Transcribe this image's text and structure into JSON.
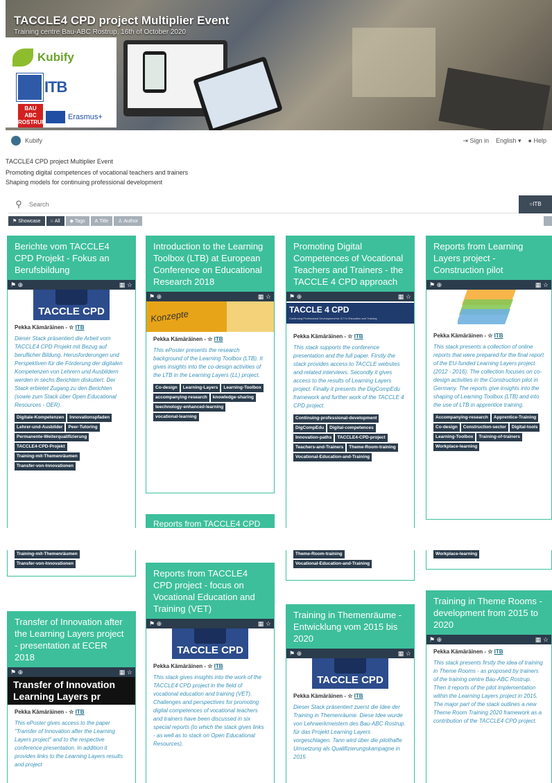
{
  "banner": {
    "title": "TACCLE4 CPD project Multiplier Event",
    "subtitle": "Training centre Bau-ABC Rostrup, 16th of October 2020",
    "kubify": "Kubify",
    "itb": "ITB",
    "bau": "BAU ABC ROSTRUP",
    "erasmus": "Erasmus+"
  },
  "nav": {
    "brand": "Kubify",
    "signin": "Sign in",
    "language": "English",
    "help": "Help"
  },
  "description": {
    "line1": "TACCLE4 CPD project Multiplier Event",
    "line2": "Promoting digital competences of vocational teachers and trainers",
    "line3": "Shaping models for continuing professional development"
  },
  "search": {
    "placeholder": "Search",
    "itb_button": "ITB"
  },
  "filters": [
    "Showcase",
    "All",
    "Tags",
    "Title",
    "Author"
  ],
  "author_name": "Pekka Kämäräinen - ☆",
  "author_org": "ITB",
  "cards": [
    {
      "title": "Berichte vom TACCLE4 CPD Projekt - Fokus an Berufsbildung",
      "image": "TACCLE CPD",
      "desc": "Dieser Stack präsentiert die Arbeit vom TACCLE4 CPD Projekt mit Bezug auf beruflicher Bildung. Herusforderungen und Perspektiven für die Förderung der digitalen Kompetenzen von Lehrern und Ausbildern werden in sechs Berichten diskutiert. Der Stack erbietet Zugang zu den Berichten (sowie zum Stack über Open Educational Resources - OER).",
      "tags": [
        "Digitale-Kompetenzen",
        "Innovationspfaden",
        "Lehrer-und-Ausbilder",
        "Peer-Tutoring",
        "Permanente-Weiterqualifizierung",
        "TACCLE4-CPD-Projekt",
        "Training-mit-Themenräumen",
        "Transfer-von-Innovationen"
      ]
    },
    {
      "title": "Introduction to the Learning Toolbox (LTB) at European Conference on Educational Research 2018",
      "image": "Konzepte",
      "desc": "This ePoster presents the research background of the Learning Toolbox (LTB). It gives insights into the co-design activities of the LTB in the Learning Layers (LL) project.",
      "tags": [
        "Co-design",
        "Learning-Layers",
        "Learning-Toolbox",
        "accompanying-research",
        "knowledge-sharing",
        "teechnology-enhanced-learning",
        "vocational-learning"
      ]
    },
    {
      "title": "Promoting Digital Competences of Vocational Teachers and Trainers - the TACCLE 4 CPD approach",
      "image": "TACCLE 4 CPD",
      "image_sub": "Continuing Professional Development for ICT in Education and Training",
      "desc": "This stack supports the conference presentation and the full paper. Firstly the stack provides access to TACCLE websites and related interviews. Secondly it gives access to the results of Learning Layers project. Finally it presents the DigCompEdu framework and further work of the TACCLE 4 CPD project.",
      "tags": [
        "Continuing-professional-development",
        "DigCompEdu",
        "Digital-competences",
        "Innovation-paths",
        "TACCLE4-CPD-project",
        "Teachers-and-Trainers",
        "Theme-Room-training",
        "Vocational-Education-and-Training"
      ]
    },
    {
      "title": "Reports from Learning Layers project - Construction pilot",
      "image": "layers",
      "desc": "This stack presents a collection of online reports that were prepared for the final report of the EU-funded Learning Layers project (2012 - 2016). The collection focuses on co-design activities in the Construction pilot in Germany. The reports give insights into the shaping of Learning Toolbox (LTB) and into the use of LTB in apprentice training.",
      "tags": [
        "Accompanying-research",
        "Apprentice-Training",
        "Co-design",
        "Construction-sector",
        "Digital-tools",
        "Learning-Toolbox",
        "Training-of-trainers",
        "Workplace-learning"
      ]
    },
    {
      "title": "Reports from TACCLE4 CPD project - focus on Vocational Education and Training (VET)",
      "image": "TACCLE CPD",
      "desc": "This stack gives insights into the work of the TACCLE4 CPD project in the field of vocational education and training (VET). Challenges and perspectives for promoting digital competences of vocational teachers and trainers have been discussed in six special reports (to which the stack gives links - as well as to stack on Open Educational Resources).",
      "tags": []
    },
    {
      "title": "Transfer of Innovation after the Learning Layers project - presentation at ECER 2018",
      "image": "Transfer of Innovation Learning Layers pr",
      "desc": "This ePoster gives access to the paper \"Transfer of Innovation after the Learning Layers project\" and to the respective conference presentation. In addition it provides links to the Learning Layers results and project",
      "tags": []
    },
    {
      "title": "Training in Themenräume - Entwicklung vom 2015 bis 2020",
      "image": "TACCLE CPD",
      "desc": "Dieser Stack präsentiert zuerst die Idee der Training in Themenräume. Diese Idee wurde von Lehrwerkmeistern des Bau-ABC Rostrup. für das Projekt Learning Layers vorgeschlagen. Tann wird über die pilothafte Umsetzung als Qualifizierungskampagne in 2015",
      "tags": []
    },
    {
      "title": "Training in Theme Rooms - development from 2015 to 2020",
      "image": "",
      "desc": "This stack presents firstly the idea of training in Theme Rooms - as proposed by trainers of the training centre Bau-ABC Rostrup. Then it reports of the pilot implementation within the Learning Layers project in 2015. The major part of the stack outlines a new Theme Room Training 2020 framework as a contribution of the TACCLE4 CPD project.",
      "tags": []
    }
  ],
  "peek_title": "Reports from TACCLE4 CPD",
  "dup_tags_1": [
    "TACCLE4-CPD-Projekt",
    "Training-mit-Themenräumen",
    "Transfer-von-Innovationen"
  ],
  "dup_tags_3": [
    "Theme-Room-training",
    "Vocational-Education-and-Training"
  ],
  "dup_tags_4": [
    "Workplace-learning"
  ],
  "colors": {
    "accent": "#3dbf9b",
    "dark": "#2b3c4c",
    "desc": "#3891b8"
  }
}
